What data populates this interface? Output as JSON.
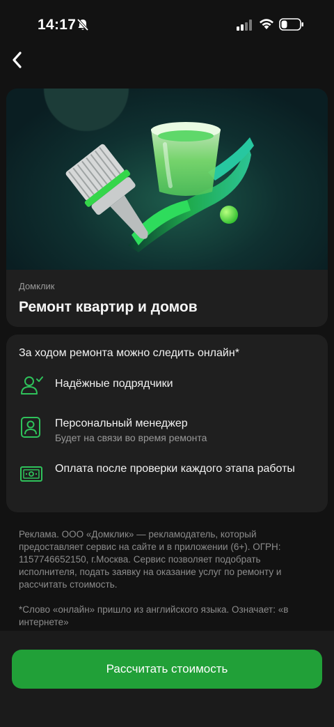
{
  "status_bar": {
    "time": "14:17"
  },
  "nav": {
    "back_icon": "chevron-left-icon"
  },
  "hero": {
    "source": "Домклик",
    "title": "Ремонт квартир и домов"
  },
  "features": {
    "heading": "За ходом ремонта можно следить онлайн*",
    "items": [
      {
        "icon": "person-check-icon",
        "title": "Надёжные подрядчики",
        "subtitle": ""
      },
      {
        "icon": "manager-icon",
        "title": "Персональный менеджер",
        "subtitle": "Будет на связи во время ремонта"
      },
      {
        "icon": "banknote-icon",
        "title": "Оплата после проверки каждого этапа работы",
        "subtitle": ""
      }
    ]
  },
  "disclaimer": {
    "ad": "Реклама. ООО «Домклик» — рекламодатель, который предоставляет сервис на сайте и в приложении (6+). ОГРН: 1157746652150, г.Москва. Сервис позволяет подобрать исполнителя, подать заявку на оказание услуг по ремонту и рассчитать стоимость.",
    "footnote": "*Слово «онлайн» пришло из английского языка. Означает: «в интернете»"
  },
  "cta": {
    "label": "Рассчитать стоимость"
  },
  "colors": {
    "accent": "#21a038",
    "icon_green": "#2fc25b",
    "background": "#121212",
    "card": "#1f1f1f"
  }
}
